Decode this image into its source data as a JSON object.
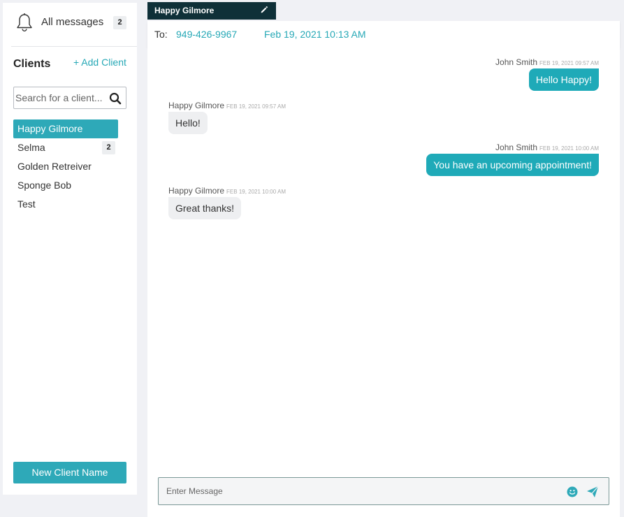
{
  "sidebar": {
    "all_messages": {
      "label": "All messages",
      "count": "2",
      "icon": "bell-icon"
    },
    "clients_title": "Clients",
    "add_client_label": "+ Add Client",
    "search": {
      "placeholder": "Search for a client...",
      "value": "",
      "icon": "search-icon"
    },
    "clients": [
      {
        "name": "Happy Gilmore",
        "active": true,
        "badge": ""
      },
      {
        "name": "Selma",
        "active": false,
        "badge": "2"
      },
      {
        "name": "Golden Retreiver",
        "active": false,
        "badge": ""
      },
      {
        "name": "Sponge Bob",
        "active": false,
        "badge": ""
      },
      {
        "name": "Test",
        "active": false,
        "badge": ""
      }
    ],
    "new_client_button": "New Client Name"
  },
  "conversation": {
    "tab_title": "Happy Gilmore",
    "edit_icon": "pencil-icon",
    "to_label": "To:",
    "phone": "949-426-9967",
    "date": "Feb 19, 2021 10:13 AM",
    "messages": [
      {
        "direction": "out",
        "sender": "John Smith",
        "timestamp": "FEB 19, 2021 09:57 AM",
        "text": "Hello Happy!"
      },
      {
        "direction": "in",
        "sender": "Happy Gilmore",
        "timestamp": "FEB 19, 2021 09:57 AM",
        "text": "Hello!"
      },
      {
        "direction": "out",
        "sender": "John Smith",
        "timestamp": "FEB 19, 2021 10:00 AM",
        "text": "You have an upcoming appointment!"
      },
      {
        "direction": "in",
        "sender": "Happy Gilmore",
        "timestamp": "FEB 19, 2021 10:00 AM",
        "text": "Great thanks!"
      }
    ],
    "composer": {
      "placeholder": "Enter Message",
      "value": "",
      "emoji_icon": "smile-icon",
      "send_icon": "send-icon"
    }
  },
  "colors": {
    "accent": "#2ea9b8",
    "tab_bg": "#0f3038",
    "incoming_bubble": "#eeeff1",
    "page_bg": "#f0f1f5"
  }
}
